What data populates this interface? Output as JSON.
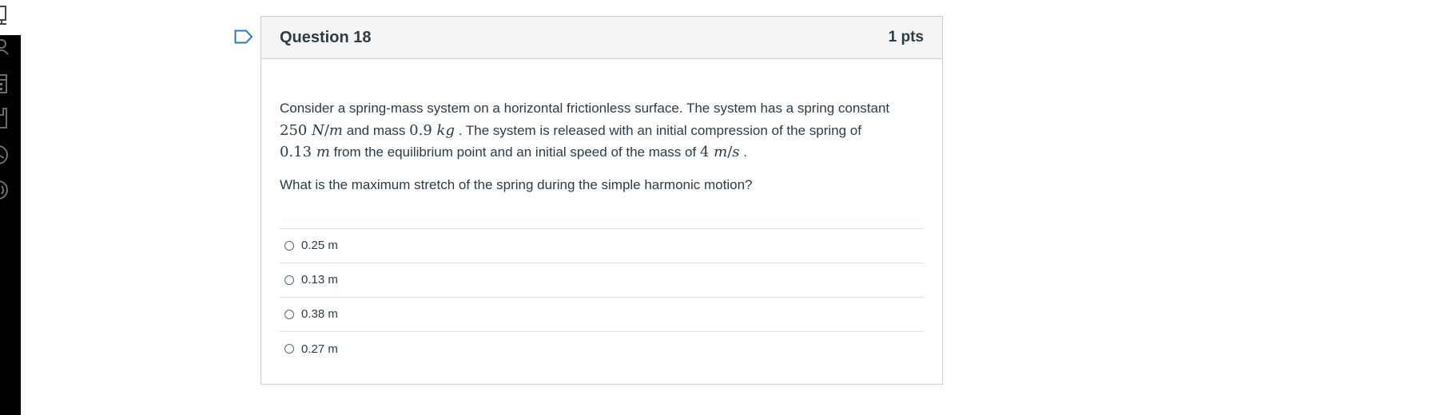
{
  "question": {
    "title": "Question 18",
    "points": "1 pts",
    "text_parts": {
      "p1": "Consider a spring-mass system on a horizontal frictionless surface. The system has a spring constant",
      "k_value": "250",
      "k_unit_n": "N",
      "k_unit_sep": "/",
      "k_unit_m": "m",
      "p2": " and mass ",
      "mass_value": "0.9",
      "mass_unit": "kg",
      "p3": ". The system is released with an initial compression of the spring of",
      "comp_value": "0.13",
      "comp_unit": "m",
      "p4": " from the equilibrium point and an initial speed of the mass of ",
      "speed_value": "4",
      "speed_unit_m": "m",
      "speed_unit_sep": "/",
      "speed_unit_s": "s",
      "p5": "."
    },
    "prompt": "What is the maximum stretch of the spring during the simple harmonic motion?",
    "answers": [
      {
        "label": "0.25 m"
      },
      {
        "label": "0.13 m"
      },
      {
        "label": "0.38 m"
      },
      {
        "label": "0.27 m"
      }
    ]
  },
  "icons": {
    "flag": "bookmark-flag-icon",
    "nav": [
      "monitor-icon",
      "people-icon",
      "calendar-icon",
      "inbox-icon",
      "clock-icon",
      "help-icon"
    ]
  }
}
